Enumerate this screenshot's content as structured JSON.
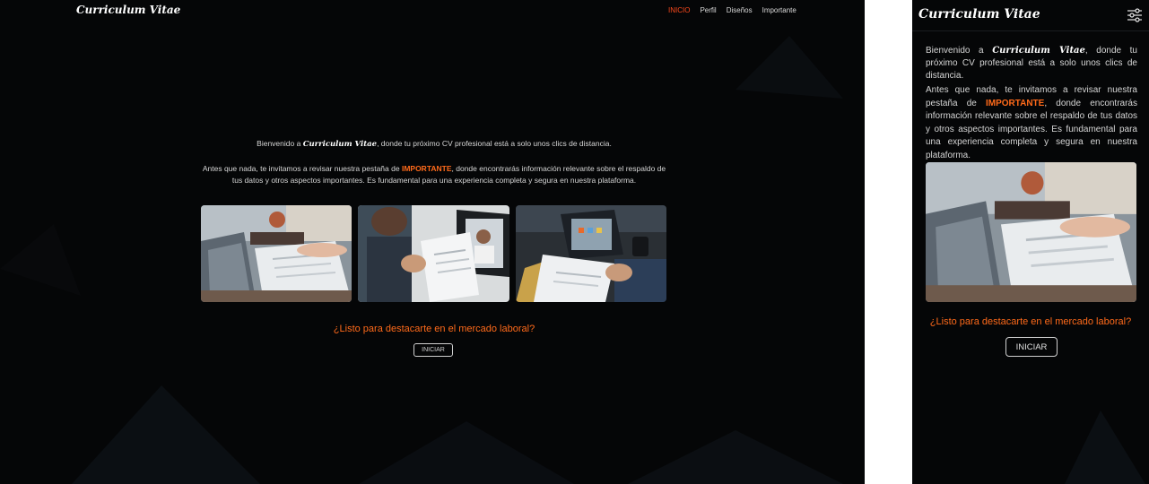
{
  "brand": "Curriculum Vitae",
  "nav": {
    "items": [
      {
        "label": "INICIO",
        "active": true
      },
      {
        "label": "Perfil",
        "active": false
      },
      {
        "label": "Diseños",
        "active": false
      },
      {
        "label": "Importante",
        "active": false
      }
    ],
    "mobile_menu_icon": "settings-sliders-icon"
  },
  "intro": {
    "welcome_prefix": "Bienvenido a ",
    "welcome_brand": "Curriculum Vitae",
    "welcome_suffix": ", donde tu próximo CV profesional está a solo unos clics de distancia.",
    "notice_prefix": "Antes que nada, te invitamos a revisar nuestra pestaña de ",
    "notice_highlight": "IMPORTANTE",
    "notice_suffix": ", donde encontrarás información relevante sobre el respaldo de tus datos y otros aspectos importantes. Es fundamental para una experiencia completa y segura en nuestra plataforma."
  },
  "gallery": [
    {
      "name": "resume-on-laptop-photo"
    },
    {
      "name": "video-call-resume-photo"
    },
    {
      "name": "reviewing-documents-photo"
    }
  ],
  "cta": {
    "question": "¿Listo para destacarte en el mercado laboral?",
    "button_label": "INICIAR"
  },
  "colors": {
    "background": "#050607",
    "accent": "#ff4a1c",
    "highlight": "#ff6a1a",
    "text": "#d6d6d6"
  }
}
